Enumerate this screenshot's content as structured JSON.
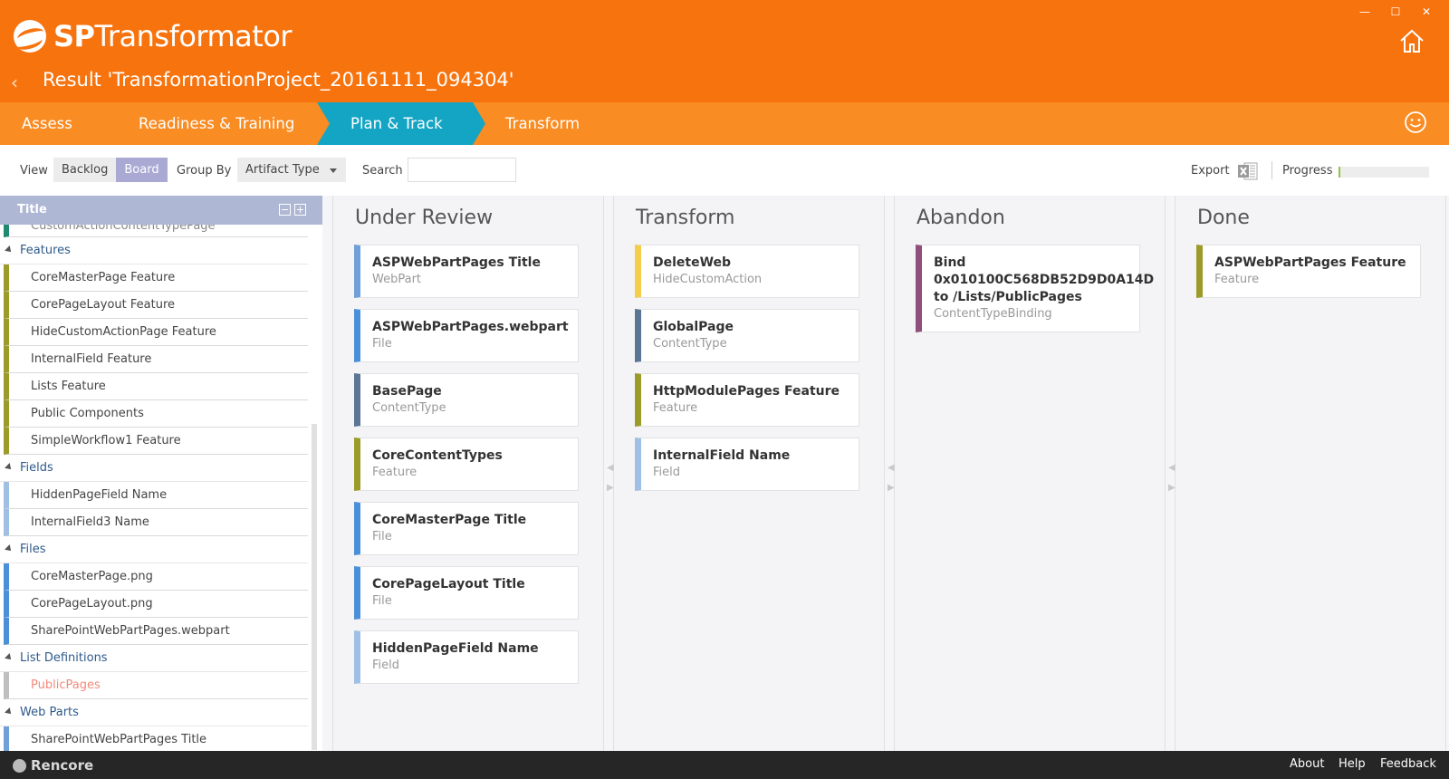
{
  "app": {
    "brand_bold": "SP",
    "brand_rest": "Transformator",
    "result_title": "Result 'TransformationProject_20161111_094304'"
  },
  "window_controls": {
    "minimize": "—",
    "maximize": "☐",
    "close": "✕"
  },
  "nav": {
    "items": [
      {
        "label": "Assess"
      },
      {
        "label": "Readiness & Training"
      },
      {
        "label": "Plan & Track"
      },
      {
        "label": "Transform"
      }
    ],
    "active": "Plan & Track"
  },
  "toolbar": {
    "view_label": "View",
    "view_options": [
      "Backlog",
      "Board"
    ],
    "view_selected": "Board",
    "group_by_label": "Group By",
    "group_by_value": "Artifact Type",
    "search_label": "Search",
    "search_value": "",
    "export_label": "Export",
    "progress_label": "Progress",
    "progress_fraction": 0.02
  },
  "sidebar": {
    "header": "Title",
    "cut_item": "CustomActionContentTypePage",
    "groups": [
      {
        "name": "Features",
        "items": [
          "CoreMasterPage Feature",
          "CorePageLayout Feature",
          "HideCustomActionPage Feature",
          "InternalField Feature",
          "Lists Feature",
          "Public Components",
          "SimpleWorkflow1 Feature"
        ]
      },
      {
        "name": "Fields",
        "items": [
          "HiddenPageField Name",
          "InternalField3 Name"
        ]
      },
      {
        "name": "Files",
        "items": [
          "CoreMasterPage.png",
          "CorePageLayout.png",
          "SharePointWebPartPages.webpart"
        ]
      },
      {
        "name": "List Definitions",
        "items": [
          "PublicPages"
        ]
      },
      {
        "name": "Web Parts",
        "items": [
          "SharePointWebPartPages Title"
        ]
      }
    ]
  },
  "board": {
    "columns": [
      {
        "title": "Under Review",
        "cards": [
          {
            "title": "ASPWebPartPages Title",
            "type": "WebPart",
            "color": "#6fa0d8"
          },
          {
            "title": "ASPWebPartPages.webpart",
            "type": "File",
            "color": "#4a90d9"
          },
          {
            "title": "BasePage",
            "type": "ContentType",
            "color": "#5b7595"
          },
          {
            "title": "CoreContentTypes",
            "type": "Feature",
            "color": "#9b9b2a"
          },
          {
            "title": "CoreMasterPage Title",
            "type": "File",
            "color": "#4a90d9"
          },
          {
            "title": "CorePageLayout Title",
            "type": "File",
            "color": "#4a90d9"
          },
          {
            "title": "HiddenPageField Name",
            "type": "Field",
            "color": "#9fc0e4"
          }
        ]
      },
      {
        "title": "Transform",
        "cards": [
          {
            "title": "DeleteWeb",
            "type": "HideCustomAction",
            "color": "#f4cd4a"
          },
          {
            "title": "GlobalPage",
            "type": "ContentType",
            "color": "#5b7595"
          },
          {
            "title": "HttpModulePages Feature",
            "type": "Feature",
            "color": "#9b9b2a"
          },
          {
            "title": "InternalField Name",
            "type": "Field",
            "color": "#9fc0e4"
          }
        ]
      },
      {
        "title": "Abandon",
        "cards": [
          {
            "title_lines": [
              "Bind",
              "0x010100C568DB52D9D0A14D",
              "to /Lists/PublicPages"
            ],
            "type": "ContentTypeBinding",
            "color": "#8e4f7a"
          }
        ]
      },
      {
        "title": "Done",
        "cards": [
          {
            "title": "ASPWebPartPages Feature",
            "type": "Feature",
            "color": "#9b9b2a"
          }
        ]
      }
    ]
  },
  "footer": {
    "brand": "Rencore",
    "links": [
      "About",
      "Help",
      "Feedback"
    ]
  },
  "colors": {
    "header": "#f7730e",
    "nav": "#f98c23",
    "nav_active": "#14a5c4",
    "view_active": "#a9a9d4",
    "sidebar_header": "#aeb7d4",
    "footer": "#262626",
    "progress": "#8dc63f"
  }
}
